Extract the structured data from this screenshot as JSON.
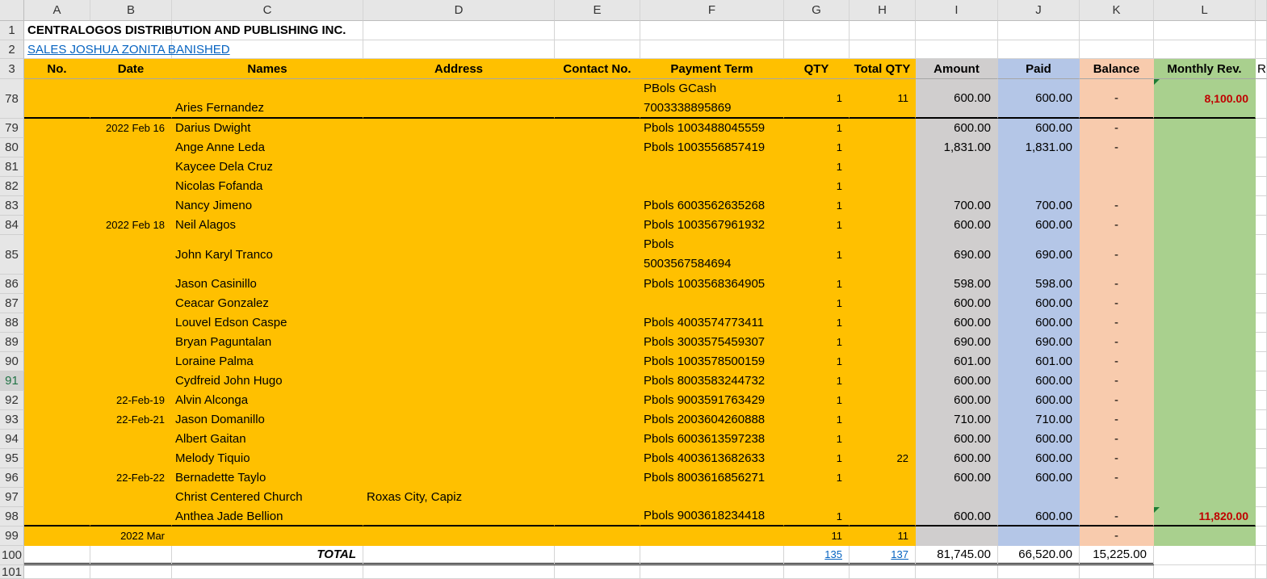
{
  "columns": [
    "A",
    "B",
    "C",
    "D",
    "E",
    "F",
    "G",
    "H",
    "I",
    "J",
    "K",
    "L"
  ],
  "title": "CENTRALOGOS DISTRIBUTION AND PUBLISHING INC.",
  "subtitle_link": "SALES JOSHUA ZONITA BANISHED",
  "headers": {
    "a": "No.",
    "b": "Date",
    "c": "Names",
    "d": "Address",
    "e": "Contact No.",
    "f": "Payment Term",
    "g": "QTY",
    "h": "Total QTY",
    "i": "Amount",
    "j": "Paid",
    "k": "Balance",
    "l": "Monthly Rev.",
    "m": "R"
  },
  "selected_row": "91",
  "colors": {
    "orange": "#FFC000",
    "gray": "#D0CECE",
    "blue": "#B4C6E7",
    "peach": "#F8CBAD",
    "green": "#A9D08E",
    "red": "#C00000"
  },
  "rows": [
    {
      "n": "78",
      "b": "",
      "c": "Aries Fernandez",
      "d": "",
      "f": "PBols GCash\n7003338895869",
      "g": "1",
      "h": "11",
      "i": "600.00",
      "j": "600.00",
      "k": "-",
      "l": "8,100.00"
    },
    {
      "n": "79",
      "b": "2022 Feb 16",
      "c": "Darius Dwight",
      "d": "",
      "f": "Pbols 1003488045559",
      "g": "1",
      "h": "",
      "i": "600.00",
      "j": "600.00",
      "k": "-",
      "l": ""
    },
    {
      "n": "80",
      "b": "",
      "c": "Ange Anne Leda",
      "d": "",
      "f": "Pbols 1003556857419",
      "g": "1",
      "h": "",
      "i": "1,831.00",
      "j": "1,831.00",
      "k": "-",
      "l": ""
    },
    {
      "n": "81",
      "b": "",
      "c": "Kaycee Dela Cruz",
      "d": "",
      "f": "",
      "g": "1",
      "h": "",
      "i": "",
      "j": "",
      "k": "",
      "l": ""
    },
    {
      "n": "82",
      "b": "",
      "c": "Nicolas Fofanda",
      "d": "",
      "f": "",
      "g": "1",
      "h": "",
      "i": "",
      "j": "",
      "k": "",
      "l": ""
    },
    {
      "n": "83",
      "b": "",
      "c": "Nancy Jimeno",
      "d": "",
      "f": "Pbols 6003562635268",
      "g": "1",
      "h": "",
      "i": "700.00",
      "j": "700.00",
      "k": "-",
      "l": ""
    },
    {
      "n": "84",
      "b": "2022 Feb 18",
      "c": "Neil Alagos",
      "d": "",
      "f": "Pbols 1003567961932",
      "g": "1",
      "h": "",
      "i": "600.00",
      "j": "600.00",
      "k": "-",
      "l": ""
    },
    {
      "n": "85",
      "b": "",
      "c": "John Karyl Tranco",
      "d": "",
      "f": "Pbols\n5003567584694",
      "g": "1",
      "h": "",
      "i": "690.00",
      "j": "690.00",
      "k": "-",
      "l": ""
    },
    {
      "n": "86",
      "b": "",
      "c": "Jason Casinillo",
      "d": "",
      "f": "Pbols 1003568364905",
      "g": "1",
      "h": "",
      "i": "598.00",
      "j": "598.00",
      "k": "-",
      "l": ""
    },
    {
      "n": "87",
      "b": "",
      "c": "Ceacar Gonzalez",
      "d": "",
      "f": "",
      "g": "1",
      "h": "",
      "i": "600.00",
      "j": "600.00",
      "k": "-",
      "l": ""
    },
    {
      "n": "88",
      "b": "",
      "c": "Louvel Edson Caspe",
      "d": "",
      "f": "Pbols 4003574773411",
      "g": "1",
      "h": "",
      "i": "600.00",
      "j": "600.00",
      "k": "-",
      "l": ""
    },
    {
      "n": "89",
      "b": "",
      "c": "Bryan Paguntalan",
      "d": "",
      "f": "Pbols 3003575459307",
      "g": "1",
      "h": "",
      "i": "690.00",
      "j": "690.00",
      "k": "-",
      "l": ""
    },
    {
      "n": "90",
      "b": "",
      "c": "Loraine Palma",
      "d": "",
      "f": "Pbols 1003578500159",
      "g": "1",
      "h": "",
      "i": "601.00",
      "j": "601.00",
      "k": "-",
      "l": ""
    },
    {
      "n": "91",
      "b": "",
      "c": "Cydfreid John Hugo",
      "d": "",
      "f": "Pbols 8003583244732",
      "g": "1",
      "h": "",
      "i": "600.00",
      "j": "600.00",
      "k": "-",
      "l": ""
    },
    {
      "n": "92",
      "b": "22-Feb-19",
      "c": "Alvin Alconga",
      "d": "",
      "f": "Pbols 9003591763429",
      "g": "1",
      "h": "",
      "i": "600.00",
      "j": "600.00",
      "k": "-",
      "l": ""
    },
    {
      "n": "93",
      "b": "22-Feb-21",
      "c": "Jason Domanillo",
      "d": "",
      "f": "Pbols 2003604260888",
      "g": "1",
      "h": "",
      "i": "710.00",
      "j": "710.00",
      "k": "-",
      "l": ""
    },
    {
      "n": "94",
      "b": "",
      "c": "Albert Gaitan",
      "d": "",
      "f": "Pbols 6003613597238",
      "g": "1",
      "h": "",
      "i": "600.00",
      "j": "600.00",
      "k": "-",
      "l": ""
    },
    {
      "n": "95",
      "b": "",
      "c": "Melody Tiquio",
      "d": "",
      "f": "Pbols 4003613682633",
      "g": "1",
      "h": "22",
      "i": "600.00",
      "j": "600.00",
      "k": "-",
      "l": ""
    },
    {
      "n": "96",
      "b": "22-Feb-22",
      "c": "Bernadette Taylo",
      "d": "",
      "f": "Pbols 8003616856271",
      "g": "1",
      "h": "",
      "i": "600.00",
      "j": "600.00",
      "k": "-",
      "l": ""
    },
    {
      "n": "97",
      "b": "",
      "c": "Christ Centered Church",
      "d": "Roxas City, Capiz",
      "f": "",
      "g": "",
      "h": "",
      "i": "",
      "j": "",
      "k": "",
      "l": ""
    },
    {
      "n": "98",
      "b": "",
      "c": "Anthea Jade Bellion",
      "d": "",
      "f": "Pbols 9003618234418",
      "g": "1",
      "h": "",
      "i": "600.00",
      "j": "600.00",
      "k": "-",
      "l": "11,820.00"
    },
    {
      "n": "99",
      "b": "2022 Mar",
      "c": "",
      "d": "",
      "f": "",
      "g": "11",
      "h": "11",
      "i": "",
      "j": "",
      "k": "-",
      "l": ""
    }
  ],
  "total": {
    "n": "100",
    "label": "TOTAL",
    "g": "135",
    "h": "137",
    "i": "81,745.00",
    "j": "66,520.00",
    "k": "15,225.00"
  },
  "last_row": "101"
}
